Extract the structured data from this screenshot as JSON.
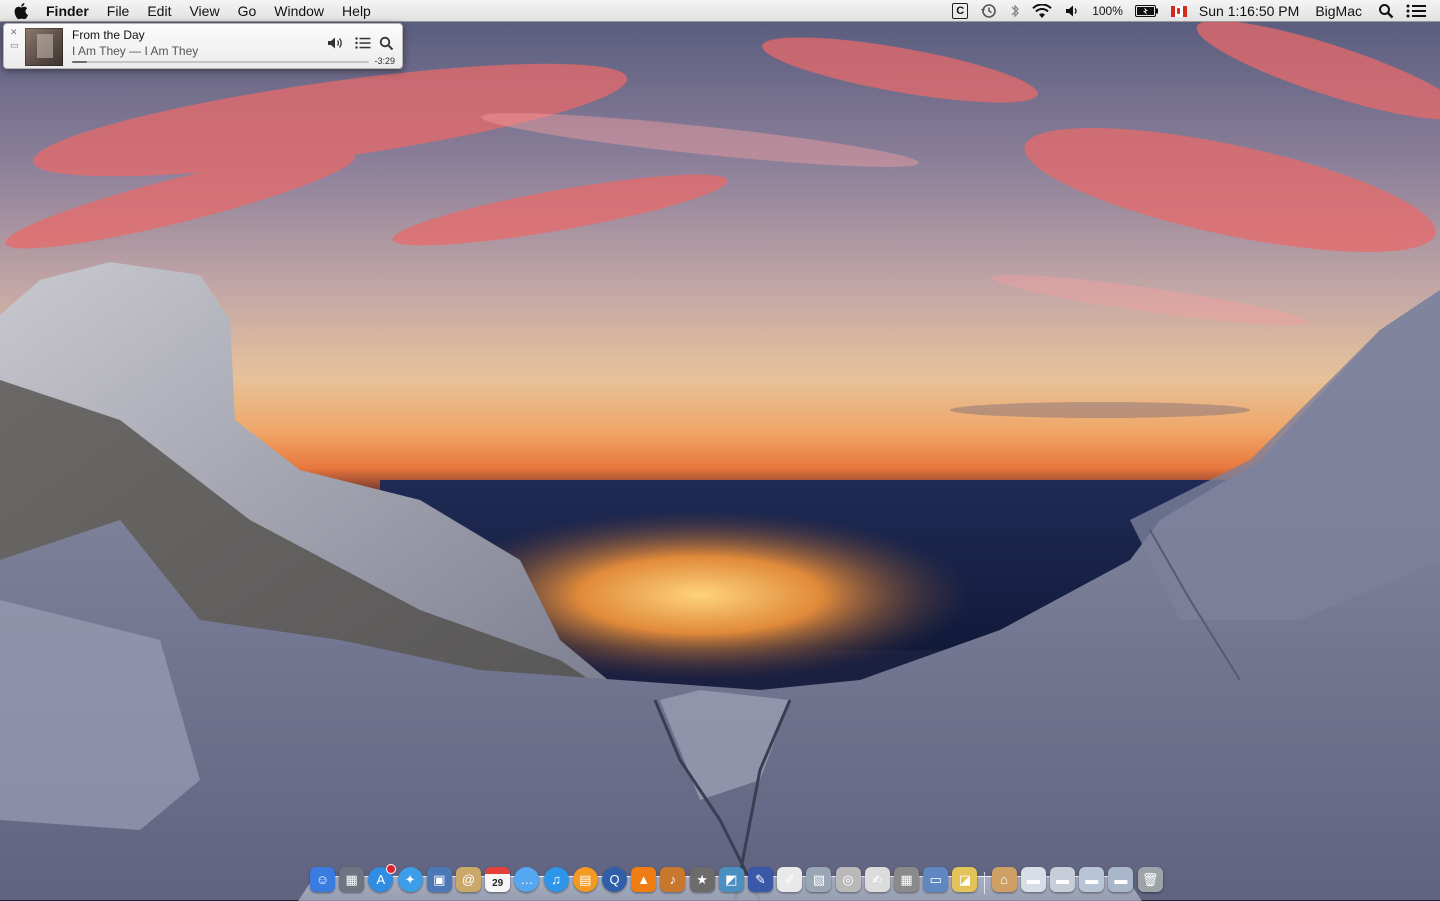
{
  "menubar": {
    "app_name": "Finder",
    "items": [
      "File",
      "Edit",
      "View",
      "Go",
      "Window",
      "Help"
    ],
    "status": {
      "c_app_label": "C",
      "battery_percent": "100%",
      "clock": "Sun 1:16:50 PM",
      "user": "BigMac"
    }
  },
  "mini_player": {
    "song": "From the Day",
    "artist_album": "I Am They — I Am They",
    "remaining": "-3:29",
    "progress": 0.05,
    "close_glyph": "✕",
    "minimize_glyph": "▭"
  },
  "dock": {
    "calendar_day": "29",
    "items": [
      {
        "name": "finder-icon",
        "glyph": "☺",
        "color": "#3a7be0"
      },
      {
        "name": "mission-control-icon",
        "glyph": "▦",
        "color": "#6e7480"
      },
      {
        "name": "app-store-icon",
        "glyph": "A",
        "color": "#2f8de4",
        "round": true,
        "badge": true
      },
      {
        "name": "safari-icon",
        "glyph": "✦",
        "color": "#3c9de8",
        "round": true
      },
      {
        "name": "preview-icon",
        "glyph": "▣",
        "color": "#4d78b8"
      },
      {
        "name": "contacts-icon",
        "glyph": "@",
        "color": "#c9a86a"
      },
      {
        "name": "calendar-icon",
        "glyph": "",
        "color": "#f3f3f3",
        "calendar": true
      },
      {
        "name": "messages-icon",
        "glyph": "…",
        "color": "#54a7f0",
        "round": true
      },
      {
        "name": "itunes-icon",
        "glyph": "♫",
        "color": "#2e96e8",
        "round": true
      },
      {
        "name": "ibooks-icon",
        "glyph": "▤",
        "color": "#f29a22",
        "round": true
      },
      {
        "name": "quicktime-icon",
        "glyph": "Q",
        "color": "#2f5fa8",
        "round": true
      },
      {
        "name": "vlc-icon",
        "glyph": "▲",
        "color": "#f07d13"
      },
      {
        "name": "garageband-icon",
        "glyph": "♪",
        "color": "#c7782e"
      },
      {
        "name": "imovie-icon",
        "glyph": "★",
        "color": "#6c6c6c"
      },
      {
        "name": "iphoto-icon",
        "glyph": "◩",
        "color": "#4a8fbf"
      },
      {
        "name": "instruments-icon",
        "glyph": "✎",
        "color": "#3b57a8"
      },
      {
        "name": "textedit-icon",
        "glyph": "✐",
        "color": "#e9e9e9"
      },
      {
        "name": "photo-viewer-icon",
        "glyph": "▧",
        "color": "#9aa6b5"
      },
      {
        "name": "dvd-player-icon",
        "glyph": "◎",
        "color": "#b9b9b9"
      },
      {
        "name": "script-editor-icon",
        "glyph": "✍",
        "color": "#dcdcdc"
      },
      {
        "name": "calculator-icon",
        "glyph": "▦",
        "color": "#8a8a8a"
      },
      {
        "name": "system-info-icon",
        "glyph": "▭",
        "color": "#5f87c2"
      },
      {
        "name": "grapher-icon",
        "glyph": "◪",
        "color": "#e3c35a"
      },
      {
        "name": "home-folder-icon",
        "glyph": "⌂",
        "color": "#cfa066",
        "after_separator": true
      },
      {
        "name": "documents-stack-icon",
        "glyph": "▬",
        "color": "#d8dde6"
      },
      {
        "name": "downloads-stack-icon",
        "glyph": "▬",
        "color": "#c7ceda"
      },
      {
        "name": "applications-stack-icon",
        "glyph": "▬",
        "color": "#b9c4d6"
      },
      {
        "name": "utilities-stack-icon",
        "glyph": "▬",
        "color": "#aab6c9"
      },
      {
        "name": "trash-icon",
        "glyph": "🗑",
        "color": "#9ea3a9"
      }
    ]
  }
}
